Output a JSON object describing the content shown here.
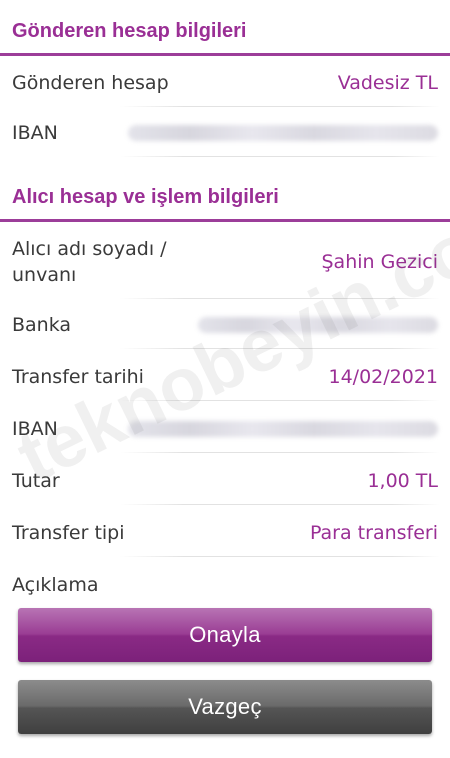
{
  "sender_section": {
    "title": "Gönderen hesap bilgileri",
    "rows": [
      {
        "label": "Gönderen hesap",
        "value": "Vadesiz TL"
      },
      {
        "label": "IBAN"
      }
    ]
  },
  "recipient_section": {
    "title": "Alıcı hesap ve işlem bilgileri",
    "rows": [
      {
        "label": "Alıcı adı soyadı /\nunvanı",
        "value": "Şahin Gezici"
      },
      {
        "label": "Banka"
      },
      {
        "label": "Transfer tarihi",
        "value": "14/02/2021"
      },
      {
        "label": "IBAN"
      },
      {
        "label": "Tutar",
        "value": "1,00 TL"
      },
      {
        "label": "Transfer tipi",
        "value": "Para transferi"
      },
      {
        "label": "Açıklama"
      }
    ]
  },
  "buttons": {
    "approve": "Onayla",
    "cancel": "Vazgeç"
  },
  "watermark": "teknobeyin.com",
  "colors": {
    "accent": "#9a2f95",
    "label": "#3a3a3a",
    "cancel_button": "#5a5a5a"
  }
}
